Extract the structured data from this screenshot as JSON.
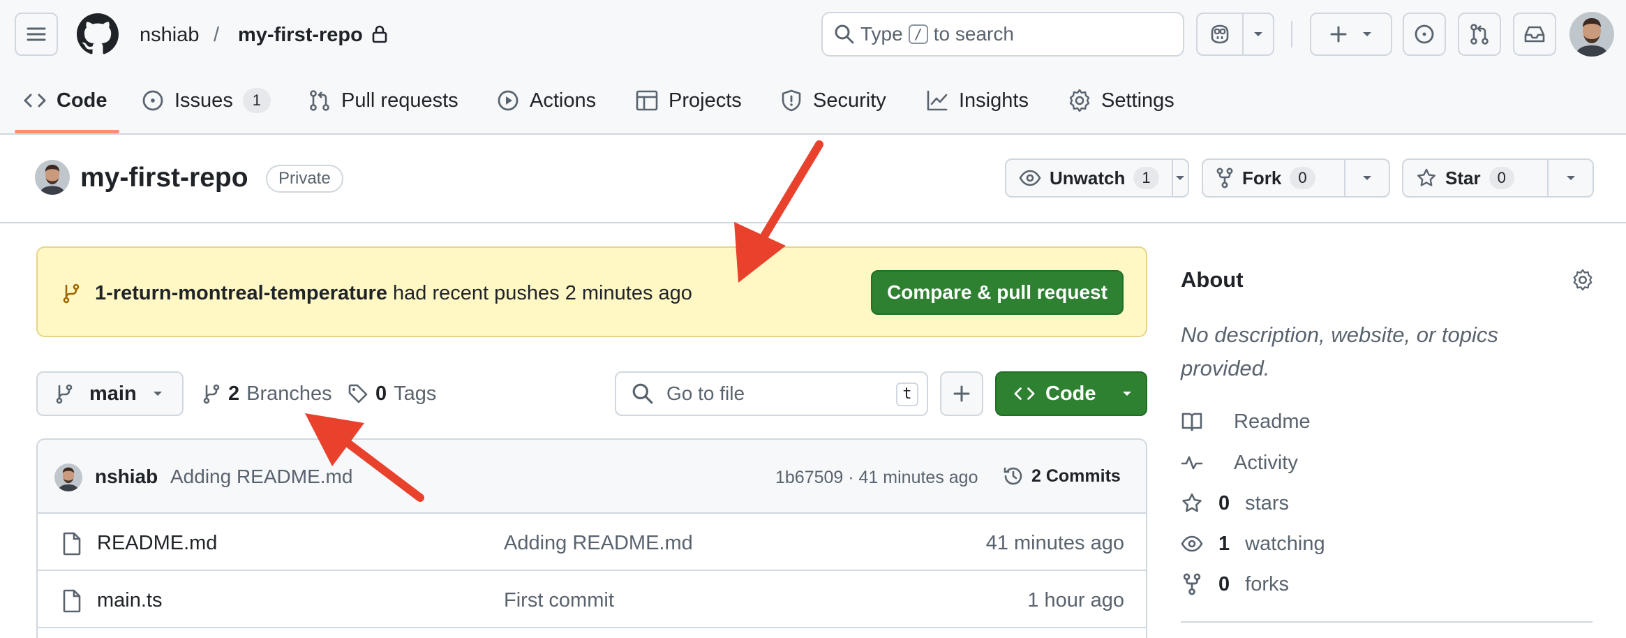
{
  "header": {
    "owner": "nshiab",
    "separator": "/",
    "repo": "my-first-repo",
    "search_prefix": "Type",
    "search_key": "/",
    "search_suffix": "to search"
  },
  "tabs": [
    {
      "label": "Code",
      "icon": "code-icon",
      "active": true
    },
    {
      "label": "Issues",
      "icon": "issue-opened-icon",
      "count": "1"
    },
    {
      "label": "Pull requests",
      "icon": "git-pull-request-icon"
    },
    {
      "label": "Actions",
      "icon": "play-icon"
    },
    {
      "label": "Projects",
      "icon": "table-icon"
    },
    {
      "label": "Security",
      "icon": "shield-icon"
    },
    {
      "label": "Insights",
      "icon": "graph-icon"
    },
    {
      "label": "Settings",
      "icon": "gear-icon"
    }
  ],
  "repo_header": {
    "title": "my-first-repo",
    "visibility": "Private",
    "unwatch_label": "Unwatch",
    "unwatch_count": "1",
    "fork_label": "Fork",
    "fork_count": "0",
    "star_label": "Star",
    "star_count": "0"
  },
  "banner": {
    "branch": "1-return-montreal-temperature",
    "message": "had recent pushes 2 minutes ago",
    "button": "Compare & pull request"
  },
  "toolbar": {
    "branch": "main",
    "branches_count": "2",
    "branches_label": "Branches",
    "tags_count": "0",
    "tags_label": "Tags",
    "goto_placeholder": "Go to file",
    "goto_key": "t",
    "code_button": "Code"
  },
  "latest_commit": {
    "author": "nshiab",
    "message": "Adding README.md",
    "meta": "1b67509 · 41 minutes ago",
    "commits_label": "2 Commits"
  },
  "files": [
    {
      "name": "README.md",
      "message": "Adding README.md",
      "time": "41 minutes ago"
    },
    {
      "name": "main.ts",
      "message": "First commit",
      "time": "1 hour ago"
    }
  ],
  "about": {
    "title": "About",
    "description": "No description, website, or topics provided.",
    "items": [
      {
        "icon": "book-icon",
        "value": "",
        "label": "Readme"
      },
      {
        "icon": "pulse-icon",
        "value": "",
        "label": "Activity"
      },
      {
        "icon": "star-icon",
        "value": "0",
        "label": "stars"
      },
      {
        "icon": "eye-icon",
        "value": "1",
        "label": "watching"
      },
      {
        "icon": "repo-forked-icon",
        "value": "0",
        "label": "forks"
      }
    ]
  },
  "colors": {
    "primary_button": "#2f8132",
    "banner_bg": "#fff8c5",
    "annotation_arrow": "#e8412c",
    "active_tab_underline": "#fd8c73"
  }
}
